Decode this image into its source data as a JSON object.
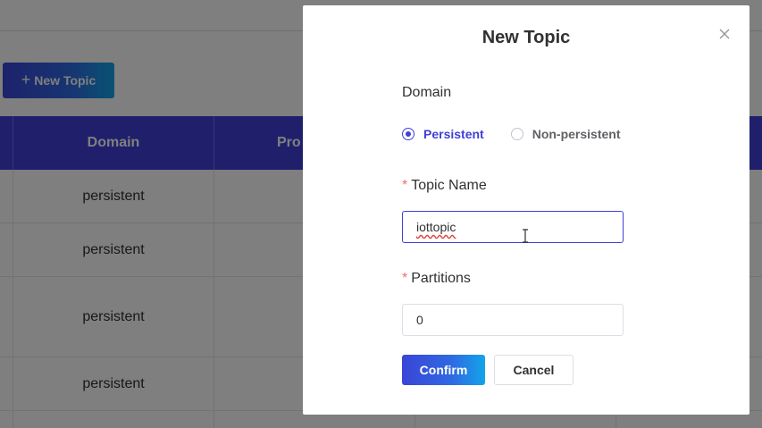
{
  "page": {
    "new_topic_button": "New Topic",
    "table": {
      "headers": [
        "Domain",
        "Pro"
      ],
      "rows": [
        {
          "domain": "persistent"
        },
        {
          "domain": "persistent"
        },
        {
          "domain": "persistent"
        },
        {
          "domain": "persistent"
        }
      ]
    }
  },
  "dialog": {
    "title": "New Topic",
    "close_icon": "close-icon",
    "domain_label": "Domain",
    "radio_options": [
      "Persistent",
      "Non-persistent"
    ],
    "selected_option": "Persistent",
    "topic_name_label": "Topic Name",
    "topic_name_value": "iottopic",
    "partitions_label": "Partitions",
    "partitions_value": "0",
    "confirm_label": "Confirm",
    "cancel_label": "Cancel"
  },
  "colors": {
    "accent": "#3f3fd8",
    "required": "#f56c6c",
    "overlay": "rgba(0,0,0,0.5)"
  }
}
